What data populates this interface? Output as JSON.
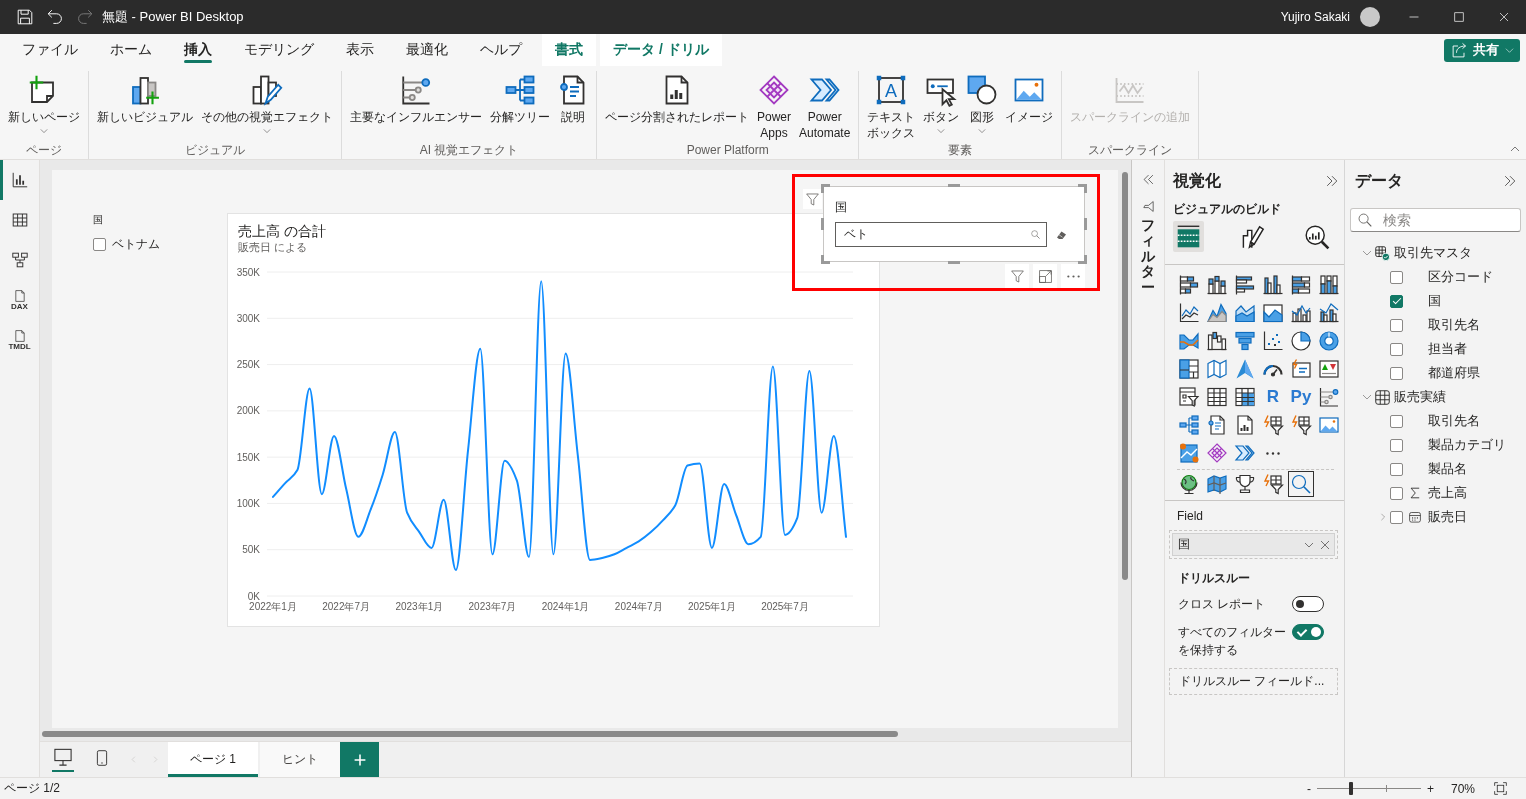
{
  "window": {
    "title": "無題 - Power BI Desktop",
    "user": "Yujiro Sakaki"
  },
  "quick_access": [
    {
      "kind": "save",
      "disabled": false
    },
    {
      "kind": "undo",
      "disabled": false
    },
    {
      "kind": "redo",
      "disabled": true
    }
  ],
  "ribbon": {
    "tabs": [
      {
        "label": "ファイル",
        "selected": false,
        "kind": "main"
      },
      {
        "label": "ホーム",
        "selected": false,
        "kind": "main"
      },
      {
        "label": "挿入",
        "selected": true,
        "kind": "main"
      },
      {
        "label": "モデリング",
        "selected": false,
        "kind": "main"
      },
      {
        "label": "表示",
        "selected": false,
        "kind": "main"
      },
      {
        "label": "最適化",
        "selected": false,
        "kind": "main"
      },
      {
        "label": "ヘルプ",
        "selected": false,
        "kind": "main"
      },
      {
        "label": "書式",
        "selected": false,
        "kind": "context"
      },
      {
        "label": "データ / ドリル",
        "selected": false,
        "kind": "context"
      }
    ],
    "share": "共有",
    "groups": [
      {
        "label": "ページ",
        "buttons": [
          {
            "kind": "new-page",
            "label": "新しいページ",
            "dropdown": true,
            "disabled": false
          }
        ]
      },
      {
        "label": "ビジュアル",
        "buttons": [
          {
            "kind": "new-visual",
            "label": "新しいビジュアル",
            "dropdown": false,
            "disabled": false
          },
          {
            "kind": "more-visuals",
            "label": "その他の視覚エフェクト",
            "dropdown": true,
            "disabled": false
          }
        ]
      },
      {
        "label": "AI 視覚エフェクト",
        "buttons": [
          {
            "kind": "influencers",
            "label": "主要なインフルエンサー",
            "dropdown": false,
            "disabled": false
          },
          {
            "kind": "decomposition",
            "label": "分解ツリー",
            "dropdown": false,
            "disabled": false
          },
          {
            "kind": "narrative",
            "label": "説明",
            "dropdown": false,
            "disabled": false
          }
        ]
      },
      {
        "label": "Power Platform",
        "buttons": [
          {
            "kind": "paginated",
            "label": "ページ分割されたレポート",
            "dropdown": false,
            "disabled": false
          },
          {
            "kind": "apps",
            "label": "Power Apps",
            "dropdown": false,
            "disabled": false
          },
          {
            "kind": "automate",
            "label": "Power Automate",
            "dropdown": false,
            "disabled": false
          }
        ]
      },
      {
        "label": "要素",
        "buttons": [
          {
            "kind": "textbox",
            "label": [
              "テキスト",
              "ボックス"
            ],
            "glyph": "A",
            "dropdown": false,
            "disabled": false
          },
          {
            "kind": "button",
            "label": "ボタン",
            "dropdown": true,
            "disabled": false
          },
          {
            "kind": "shapes",
            "label": "図形",
            "dropdown": true,
            "disabled": false
          },
          {
            "kind": "image",
            "label": "イメージ",
            "dropdown": false,
            "disabled": false
          }
        ]
      },
      {
        "label": "スパークライン",
        "buttons": [
          {
            "kind": "sparkline",
            "label": "スパークラインの追加",
            "dropdown": false,
            "disabled": true
          }
        ]
      }
    ]
  },
  "rail": [
    {
      "kind": "report",
      "selected": true
    },
    {
      "kind": "table",
      "selected": false
    },
    {
      "kind": "model",
      "selected": false
    },
    {
      "kind": "dax",
      "label": "DAX",
      "selected": false
    },
    {
      "kind": "tmdl",
      "label": "TMDL",
      "selected": false
    }
  ],
  "canvas": {
    "list_slicer": {
      "title": "国",
      "items": [
        {
          "label": "ベトナム",
          "checked": false
        }
      ]
    },
    "chart": {
      "title": "売上高 の合計",
      "subtitle": "販売日 による",
      "chart_data": {
        "type": "line",
        "grid": true,
        "categories": [
          "2022年1月",
          null,
          null,
          null,
          null,
          null,
          "2022年7月",
          null,
          null,
          null,
          null,
          null,
          "2023年1月",
          null,
          null,
          null,
          null,
          null,
          "2023年7月",
          null,
          null,
          null,
          null,
          null,
          "2024年1月",
          null,
          null,
          null,
          null,
          null,
          "2024年7月",
          null,
          null,
          null,
          null,
          null,
          "2025年1月",
          null,
          null,
          null,
          null,
          null,
          "2025年7月",
          null,
          null,
          null,
          null,
          null
        ],
        "series": [
          {
            "color": "#118dff",
            "values": [
              107000,
              122000,
              136000,
              224000,
              110000,
              173000,
              116000,
              64000,
              93000,
              131000,
              177000,
              90000,
              69000,
              52000,
              104000,
              28000,
              158000,
              267000,
              45000,
              146000,
              125000,
              42000,
              340000,
              45000,
              262000,
              152000,
              39000,
              41000,
              45000,
              52000,
              59000,
              69000,
              82000,
              98000,
              141000,
              143000,
              52000,
              121000,
              87000,
              56000,
              64000,
              248000,
              66000,
              84000,
              243000,
              90000,
              173000,
              64000
            ]
          }
        ],
        "ylim": [
          0,
          350000
        ],
        "yticks": [
          {
            "value": 0,
            "label": "0K"
          },
          {
            "value": 50000,
            "label": "50K"
          },
          {
            "value": 100000,
            "label": "100K"
          },
          {
            "value": 150000,
            "label": "150K"
          },
          {
            "value": 200000,
            "label": "200K"
          },
          {
            "value": 250000,
            "label": "250K"
          },
          {
            "value": 300000,
            "label": "300K"
          },
          {
            "value": 350000,
            "label": "350K"
          }
        ]
      }
    },
    "search_slicer": {
      "title": "国",
      "value": "ベト"
    }
  },
  "filters_pane": {
    "title": "フィルター"
  },
  "visualizations": {
    "title": "視覚化",
    "subtitle": "ビジュアルのビルド",
    "modes": [
      {
        "kind": "build",
        "selected": true
      },
      {
        "kind": "format",
        "selected": false
      },
      {
        "kind": "analytics",
        "selected": false
      }
    ],
    "gallery": [
      {
        "kind": "stacked-bar"
      },
      {
        "kind": "stacked-column"
      },
      {
        "kind": "clustered-bar"
      },
      {
        "kind": "clustered-column"
      },
      {
        "kind": "full-bar"
      },
      {
        "kind": "full-column"
      },
      {
        "kind": "line"
      },
      {
        "kind": "area"
      },
      {
        "kind": "stacked-area"
      },
      {
        "kind": "full-area"
      },
      {
        "kind": "line-stacked-column"
      },
      {
        "kind": "line-clustered-column"
      },
      {
        "kind": "ribbon"
      },
      {
        "kind": "waterfall"
      },
      {
        "kind": "funnel"
      },
      {
        "kind": "scatter"
      },
      {
        "kind": "pie"
      },
      {
        "kind": "donut"
      },
      {
        "kind": "treemap"
      },
      {
        "kind": "map"
      },
      {
        "kind": "navigation-arrow"
      },
      {
        "kind": "gauge"
      },
      {
        "kind": "card"
      },
      {
        "kind": "kpi"
      },
      {
        "kind": "slicer"
      },
      {
        "kind": "table"
      },
      {
        "kind": "matrix"
      },
      {
        "kind": "script",
        "label": "R"
      },
      {
        "kind": "script",
        "label": "Py"
      },
      {
        "kind": "influencers"
      },
      {
        "kind": "decomposition"
      },
      {
        "kind": "narrative"
      },
      {
        "kind": "paginated"
      },
      {
        "kind": "smart-filter"
      },
      {
        "kind": "smart-filter"
      },
      {
        "kind": "image"
      },
      {
        "kind": "pin-map"
      },
      {
        "kind": "apps"
      },
      {
        "kind": "automate"
      },
      {
        "kind": "more"
      }
    ],
    "custom": [
      {
        "kind": "globe",
        "selected": false
      },
      {
        "kind": "filled-map",
        "selected": false
      },
      {
        "kind": "trophy",
        "selected": false
      },
      {
        "kind": "smart-filter",
        "selected": false
      },
      {
        "kind": "search",
        "selected": true
      }
    ],
    "field_label": "Field",
    "field_value": "国",
    "drillthrough": {
      "title": "ドリルスルー",
      "options": [
        {
          "label": "クロス レポート",
          "on": false
        },
        {
          "label": "すべてのフィルターを保持する",
          "on": true
        }
      ],
      "placeholder": "ドリルスルー フィールド..."
    }
  },
  "data": {
    "title": "データ",
    "search_placeholder": "検索",
    "tables": [
      {
        "name": "取引先マスタ",
        "expanded": true,
        "in_use": true,
        "fields": [
          {
            "name": "区分コード",
            "checked": false,
            "kind": "text"
          },
          {
            "name": "国",
            "checked": true,
            "kind": "text"
          },
          {
            "name": "取引先名",
            "checked": false,
            "kind": "text"
          },
          {
            "name": "担当者",
            "checked": false,
            "kind": "text"
          },
          {
            "name": "都道府県",
            "checked": false,
            "kind": "text"
          }
        ]
      },
      {
        "name": "販売実績",
        "expanded": true,
        "in_use": false,
        "fields": [
          {
            "name": "取引先名",
            "checked": false,
            "kind": "text"
          },
          {
            "name": "製品カテゴリ",
            "checked": false,
            "kind": "text"
          },
          {
            "name": "製品名",
            "checked": false,
            "kind": "text"
          },
          {
            "name": "売上高",
            "checked": false,
            "kind": "measure"
          },
          {
            "name": "販売日",
            "checked": false,
            "kind": "date",
            "expanded": false
          }
        ]
      }
    ]
  },
  "page_tabs": {
    "views": [
      {
        "kind": "desktop",
        "selected": true
      },
      {
        "kind": "mobile",
        "selected": false
      }
    ],
    "tabs": [
      {
        "label": "ページ 1",
        "selected": true
      },
      {
        "label": "ヒント",
        "selected": false
      }
    ]
  },
  "status_bar": {
    "page": "ページ 1/2",
    "zoom": {
      "minus": "-",
      "plus": "+",
      "level": 0.33,
      "reading": "70%"
    }
  }
}
